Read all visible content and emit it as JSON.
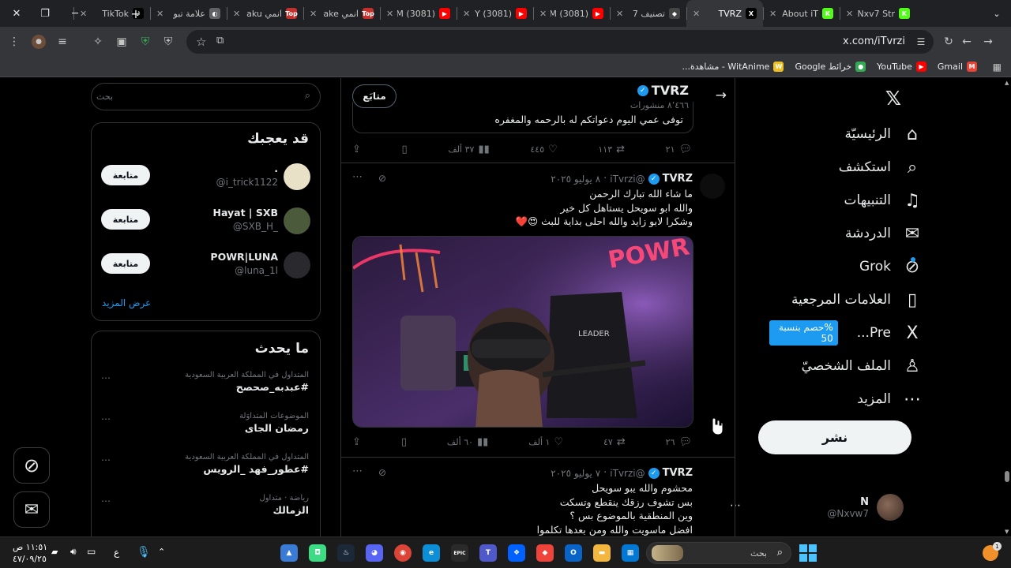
{
  "browser": {
    "tabs": [
      {
        "title": "Nxv7 Str",
        "fav_text": "K",
        "fav_color": "#53fc18",
        "active": false
      },
      {
        "title": "About iT",
        "fav_text": "K",
        "fav_color": "#53fc18",
        "active": false
      },
      {
        "title": "TVRZ",
        "fav_text": "X",
        "fav_color": "#000000",
        "active": true
      },
      {
        "title": "تصنيف 7",
        "fav_text": "◆",
        "fav_color": "#444444",
        "active": false
      },
      {
        "title": "(3081) M",
        "fav_text": "▶",
        "fav_color": "#ff0000",
        "active": false
      },
      {
        "title": "(3081) Y",
        "fav_text": "▶",
        "fav_color": "#ff0000",
        "active": false
      },
      {
        "title": "(3081) M",
        "fav_text": "▶",
        "fav_color": "#ff0000",
        "active": false
      },
      {
        "title": "انمي ake",
        "fav_text": "Top",
        "fav_color": "#c4302b",
        "active": false
      },
      {
        "title": "انمي aku",
        "fav_text": "Top",
        "fav_color": "#c4302b",
        "active": false
      },
      {
        "title": "علامة تبو",
        "fav_text": "◐",
        "fav_color": "#5f6368",
        "active": false
      },
      {
        "title": "TikTok",
        "fav_text": "♪",
        "fav_color": "#000000",
        "active": false
      }
    ],
    "url": "x.com/iTvrzi",
    "bookmarks": [
      {
        "label": "Gmail",
        "color": "#ea4335",
        "glyph": "M"
      },
      {
        "label": "YouTube",
        "color": "#ff0000",
        "glyph": "▶"
      },
      {
        "label": "خرائط Google",
        "color": "#34a853",
        "glyph": "●"
      },
      {
        "label": "WitAnime - مشاهدة...",
        "color": "#f0c020",
        "glyph": "W"
      }
    ]
  },
  "nav": {
    "items": [
      {
        "label": "الرئيسيّة",
        "icon": "⌂"
      },
      {
        "label": "استكشف",
        "icon": "⌕"
      },
      {
        "label": "التنبيهات",
        "icon": "♫"
      },
      {
        "label": "الدردشة",
        "icon": "✉"
      },
      {
        "label": "Grok",
        "icon": "⊘"
      },
      {
        "label": "العلامات المرجعية",
        "icon": "▯"
      },
      {
        "label": "Pre...",
        "icon": "X"
      },
      {
        "label": "الملف الشخصيّ",
        "icon": "♙"
      },
      {
        "label": "المزيد",
        "icon": "⋯"
      }
    ],
    "premium_badge": "%حصم بنسبة 50",
    "post_button": "نشر",
    "account": {
      "name": "N",
      "handle": "@Nxvw7"
    }
  },
  "profile_header": {
    "name": "TVRZ",
    "posts_count": "٨٬٤٦٦ منشورات",
    "follow_button": "متابَع",
    "pinned_text": "توفى عمي اليوم دعواتكم له بالرحمه والمغفره"
  },
  "tweets": [
    {
      "stats": {
        "replies": "٢١",
        "reposts": "١١٣",
        "likes": "٤٤٥",
        "views": "٣٧ ألف"
      }
    },
    {
      "name": "TVRZ",
      "handle": "@iTvrzi",
      "date": "٨ يوليو ٢٠٢٥",
      "lines": [
        "ما شاء الله تبارك الرحمن",
        "والله ابو سويحل يستاهل كل خير",
        "وشكرا لابو زايد والله احلى بداية للبث 😍❤️"
      ],
      "stats": {
        "replies": "٢٦",
        "reposts": "٤٧",
        "likes": "١ ألف",
        "views": "٦٠ ألف"
      }
    },
    {
      "name": "TVRZ",
      "handle": "@iTvrzi",
      "date": "٧ يوليو ٢٠٢٥",
      "lines": [
        "محشوم والله يبو سويحل",
        "بس تشوف رزقك ينقطع وتسكت",
        "وين المنطقية بالموضوع بس ؟",
        "افضل ماسويت والله ومن بعدها تكلموا"
      ]
    }
  ],
  "search": {
    "placeholder": "بحث"
  },
  "who_to_follow": {
    "title": "قد يعجبك",
    "users": [
      {
        "name": ".",
        "handle": "@i_trick1122",
        "button": "متابعة"
      },
      {
        "name": "Hayat | SXB",
        "handle": "@SXB_H_",
        "button": "متابعة"
      },
      {
        "name": "POWR|LUNA",
        "handle": "@luna_1l",
        "button": "متابعة"
      }
    ],
    "show_more": "عرض المزيد"
  },
  "trends": {
    "title": "ما يحدث",
    "items": [
      {
        "meta": "المتداول في المملكة العربية السعودية",
        "name": "#عبدبه_صحصح"
      },
      {
        "meta": "الموضوعات المتداوَلة",
        "name": "رمضان الجاى"
      },
      {
        "meta": "المتداول في المملكة العربية السعودية",
        "name": "#عطور_فهد _الرويس"
      },
      {
        "meta": "رياضة · متداول",
        "name": "الزمالك"
      }
    ]
  },
  "taskbar": {
    "search_placeholder": "بحث",
    "time": "١١:٥١ ص",
    "date": "٤٧/٠٩/٢٥",
    "lang": "ع",
    "apps": [
      {
        "name": "microsoft-store",
        "color": "#0078d4",
        "glyph": "▦"
      },
      {
        "name": "file-explorer",
        "color": "#f3b63f",
        "glyph": "▬"
      },
      {
        "name": "outlook",
        "color": "#0a64c8",
        "glyph": "O"
      },
      {
        "name": "anydesk",
        "color": "#ef443b",
        "glyph": "◆"
      },
      {
        "name": "dropbox",
        "color": "#0061fe",
        "glyph": "❖"
      },
      {
        "name": "teams",
        "color": "#5059c9",
        "glyph": "T"
      },
      {
        "name": "epic-games",
        "color": "#2a2a2a",
        "glyph": "EPIC"
      },
      {
        "name": "edge",
        "color": "#0c8fd6",
        "glyph": "e"
      },
      {
        "name": "chrome",
        "color": "#db4437",
        "glyph": "◉"
      },
      {
        "name": "discord",
        "color": "#5865f2",
        "glyph": "◕"
      },
      {
        "name": "steam",
        "color": "#1b2838",
        "glyph": "♨"
      },
      {
        "name": "android-app",
        "color": "#3ddc84",
        "glyph": "◘"
      },
      {
        "name": "photos",
        "color": "#3a7bd5",
        "glyph": "▲"
      }
    ]
  }
}
